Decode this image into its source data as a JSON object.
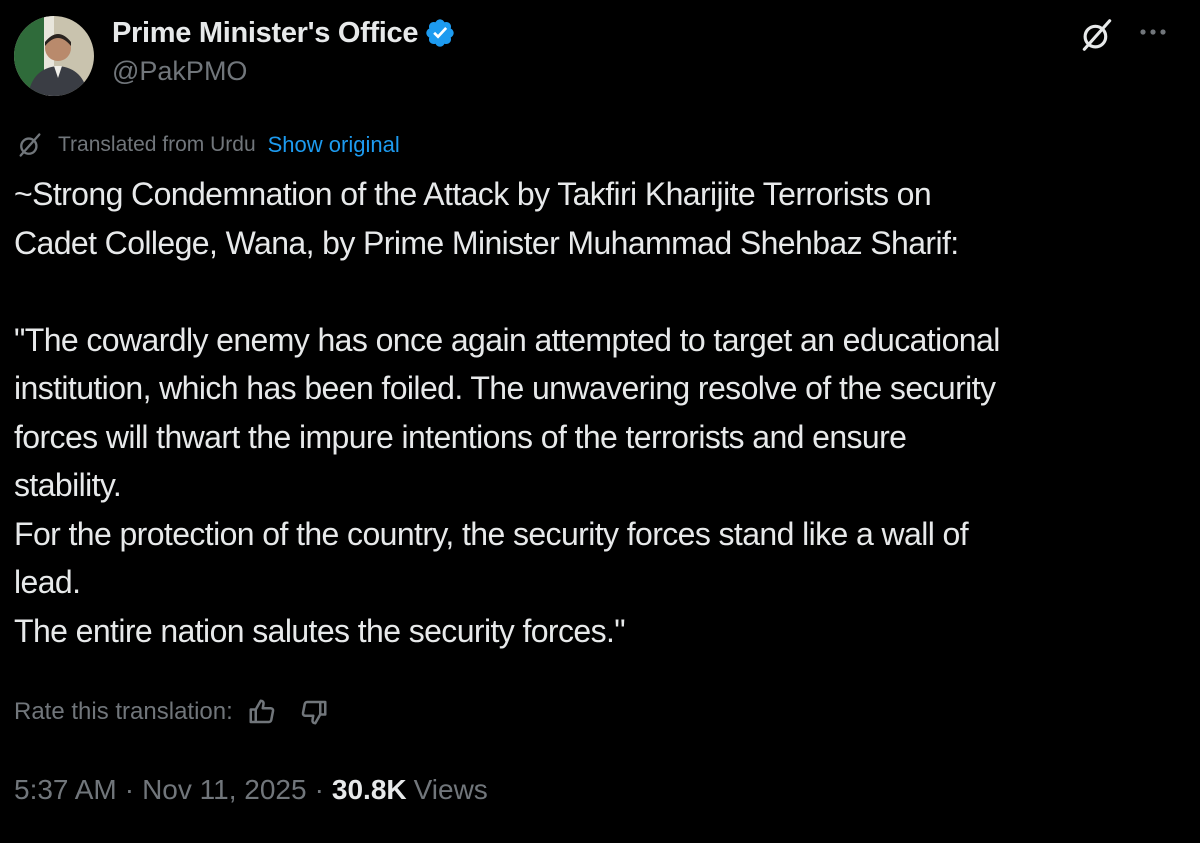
{
  "author": {
    "display_name": "Prime Minister's Office",
    "handle": "@PakPMO",
    "verified": true,
    "avatar_icon": "profile-photo"
  },
  "header_actions": {
    "grok_icon": "grok-icon",
    "more_icon": "more-options-icon"
  },
  "translation": {
    "label": "Translated from Urdu",
    "show_original": "Show original",
    "rate_label": "Rate this translation:"
  },
  "body": {
    "lines": [
      "~Strong Condemnation of the Attack by Takfiri Kharijite Terrorists on",
      "Cadet College, Wana, by Prime Minister Muhammad Shehbaz Sharif:",
      "",
      "\"The cowardly enemy has once again attempted to target an educational",
      "institution, which has been foiled. The unwavering resolve of the security",
      "forces will thwart the impure intentions of the terrorists and ensure",
      "stability.",
      "For the protection of the country, the security forces stand like a wall of",
      "lead.",
      "The entire nation salutes the security forces.\""
    ]
  },
  "meta": {
    "time": "5:37 AM",
    "separator": "·",
    "date": "Nov 11, 2025",
    "views_count": "30.8K",
    "views_label": "Views"
  },
  "colors": {
    "background": "#000000",
    "text": "#e7e9ea",
    "secondary": "#71767b",
    "link": "#1d9bf0",
    "verified": "#1d9bf0"
  }
}
